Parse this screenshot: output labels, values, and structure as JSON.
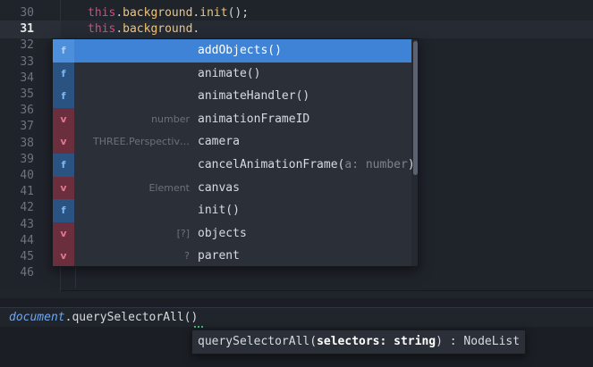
{
  "editor": {
    "line_numbers": [
      "30",
      "31",
      "32",
      "33",
      "34",
      "35",
      "36",
      "37",
      "38",
      "39",
      "40",
      "41",
      "42",
      "43",
      "44",
      "45",
      "46"
    ],
    "current_line": "31",
    "line30": {
      "kw": "this",
      "p1": ".",
      "prop1": "background",
      "p2": ".",
      "prop2": "init",
      "p3": "();"
    },
    "line31": {
      "kw": "this",
      "p1": ".",
      "prop1": "background",
      "p2": "."
    }
  },
  "autocomplete": {
    "items": [
      {
        "kind": "f",
        "left": "",
        "text": "addObjects()",
        "param": "",
        "tail": "",
        "selected": true
      },
      {
        "kind": "f",
        "left": "",
        "text": "animate()",
        "param": "",
        "tail": ""
      },
      {
        "kind": "f",
        "left": "",
        "text": "animateHandler()",
        "param": "",
        "tail": ""
      },
      {
        "kind": "v",
        "left": "number",
        "text": "animationFrameID",
        "param": "",
        "tail": ""
      },
      {
        "kind": "v",
        "left": "THREE.Perspectiv…",
        "text": "camera",
        "param": "",
        "tail": ""
      },
      {
        "kind": "f",
        "left": "",
        "text": "cancelAnimationFrame(",
        "param": "a: number",
        "tail": ")"
      },
      {
        "kind": "v",
        "left": "Element",
        "text": "canvas",
        "param": "",
        "tail": ""
      },
      {
        "kind": "f",
        "left": "",
        "text": "init()",
        "param": "",
        "tail": ""
      },
      {
        "kind": "v",
        "left": "[?]",
        "text": "objects",
        "param": "",
        "tail": ""
      },
      {
        "kind": "v",
        "left": "?",
        "text": "parent",
        "param": "",
        "tail": ""
      }
    ]
  },
  "bottom": {
    "doc": "document",
    "dot": ".",
    "call": "querySelectorAll()",
    "signature_prefix": "querySelectorAll(",
    "signature_param": "selectors: string",
    "signature_suffix": ") : NodeList"
  }
}
